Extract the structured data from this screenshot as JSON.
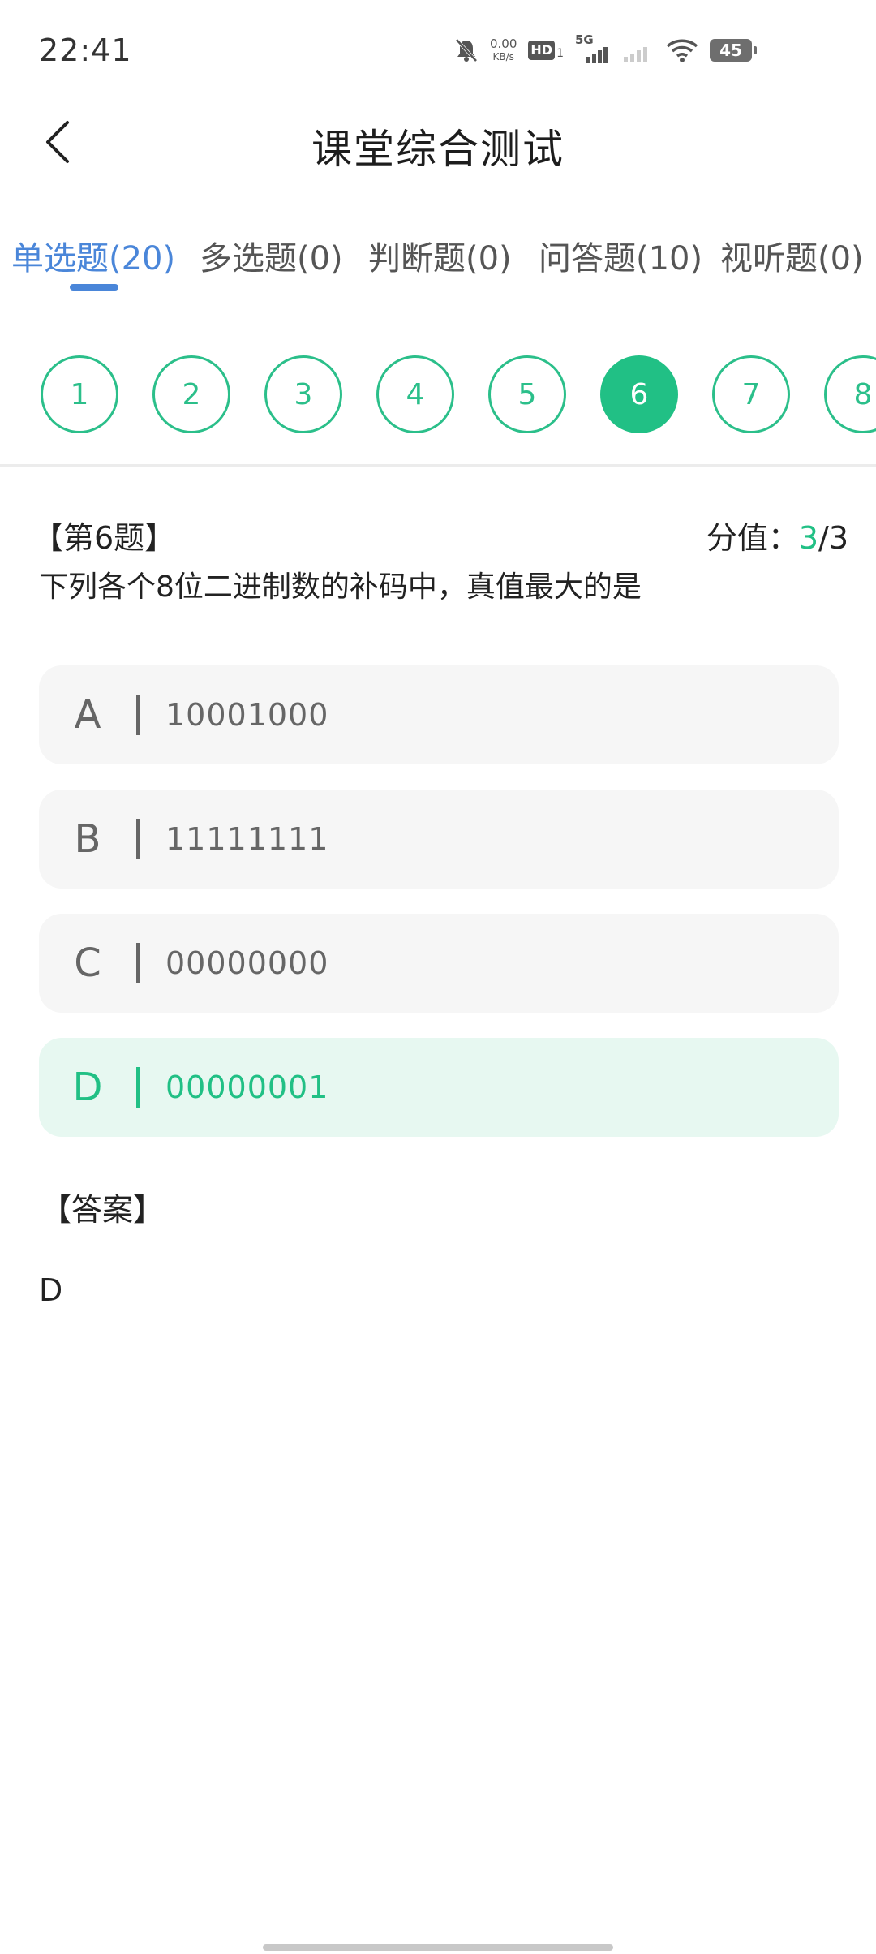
{
  "status_bar": {
    "time": "22:41",
    "net_speed_value": "0.00",
    "net_speed_unit": "KB/s",
    "hd_label": "HD",
    "hd_sub": "1",
    "network": "5G",
    "battery": "45",
    "icons": [
      "mute-bell-icon",
      "hd-icon",
      "signal-5g-icon",
      "signal-icon",
      "wifi-icon",
      "battery-icon"
    ]
  },
  "header": {
    "title": "课堂综合测试",
    "back_icon": "chevron-left-icon"
  },
  "tabs": [
    {
      "label": "单选题(20)",
      "active": true
    },
    {
      "label": "多选题(0)",
      "active": false
    },
    {
      "label": "判断题(0)",
      "active": false
    },
    {
      "label": "问答题(10)",
      "active": false
    },
    {
      "label": "视听题(0)",
      "active": false
    }
  ],
  "question_numbers": [
    "1",
    "2",
    "3",
    "4",
    "5",
    "6",
    "7",
    "8"
  ],
  "current_question_number": "6",
  "question": {
    "number_label": "【第6题】",
    "score_label": "分值：",
    "score_value": "3",
    "score_total": "/3",
    "text": "下列各个8位二进制数的补码中，真值最大的是",
    "options": [
      {
        "letter": "A",
        "text": "10001000",
        "correct": false
      },
      {
        "letter": "B",
        "text": "11111111",
        "correct": false
      },
      {
        "letter": "C",
        "text": "00000000",
        "correct": false
      },
      {
        "letter": "D",
        "text": "00000001",
        "correct": true
      }
    ],
    "answer_label": "【答案】",
    "answer_value": "D"
  },
  "colors": {
    "accent_green": "#21c085",
    "tab_active_blue": "#4a86d9",
    "option_bg": "#f6f6f6",
    "correct_bg": "#e7f8f1"
  }
}
